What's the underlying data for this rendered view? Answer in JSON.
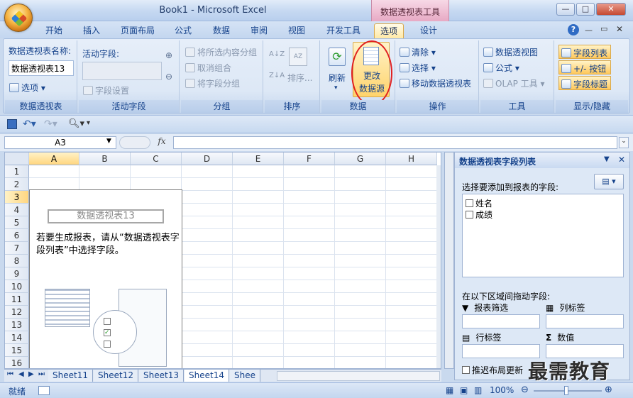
{
  "window": {
    "title": "Book1 - Microsoft Excel",
    "contextual_tools": "数据透视表工具"
  },
  "tabs": [
    "开始",
    "插入",
    "页面布局",
    "公式",
    "数据",
    "审阅",
    "视图",
    "开发工具",
    "选项",
    "设计"
  ],
  "active_tab": "选项",
  "ribbon": {
    "pivot_group": {
      "name_label": "数据透视表名称:",
      "name_value": "数据透视表13",
      "options": "选项",
      "label": "数据透视表"
    },
    "active_field_group": {
      "label_field": "活动字段:",
      "field_settings": "字段设置",
      "label": "活动字段"
    },
    "group_group": {
      "group_selection": "将所选内容分组",
      "ungroup": "取消组合",
      "group_field": "将字段分组",
      "label": "分组"
    },
    "sort_group": {
      "sort": "排序...",
      "label": "排序"
    },
    "data_group": {
      "refresh": "刷新",
      "change_source_line1": "更改",
      "change_source_line2": "数据源",
      "label": "数据"
    },
    "actions_group": {
      "clear": "清除",
      "select": "选择",
      "move": "移动数据透视表",
      "label": "操作"
    },
    "tools_group": {
      "pivot_chart": "数据透视图",
      "formulas": "公式",
      "olap": "OLAP 工具",
      "label": "工具"
    },
    "show_hide_group": {
      "field_list": "字段列表",
      "buttons": "+/- 按钮",
      "headers": "字段标题",
      "label": "显示/隐藏"
    }
  },
  "formula_bar": {
    "name_box": "A3",
    "fx": "fx",
    "formula": ""
  },
  "grid": {
    "columns": [
      "A",
      "B",
      "C",
      "D",
      "E",
      "F",
      "G",
      "H"
    ],
    "rows": [
      "1",
      "2",
      "3",
      "4",
      "5",
      "6",
      "7",
      "8",
      "9",
      "10",
      "11",
      "12",
      "13",
      "14",
      "15",
      "16"
    ],
    "selected_cell": "A3",
    "pivot_placeholder": {
      "name": "数据透视表13",
      "hint": "若要生成报表，请从“数据透视表字段列表”中选择字段。"
    }
  },
  "sheets": [
    "Sheet11",
    "Sheet12",
    "Sheet13",
    "Sheet14",
    "Shee"
  ],
  "active_sheet": "Sheet14",
  "status": {
    "ready": "就绪",
    "zoom": "100%"
  },
  "field_list_panel": {
    "title": "数据透视表字段列表",
    "choose_label": "选择要添加到报表的字段:",
    "fields": [
      "姓名",
      "成绩"
    ],
    "drag_label": "在以下区域间拖动字段:",
    "areas": {
      "report_filter": "报表筛选",
      "column_labels": "列标签",
      "row_labels": "行标签",
      "values": "数值"
    },
    "defer_update": "推迟布局更新"
  },
  "watermark": "最需教育",
  "colors": {
    "accent_tab": "#ffe9a6",
    "contextual": "#e7a9c4",
    "highlight_circle": "#e02020"
  }
}
